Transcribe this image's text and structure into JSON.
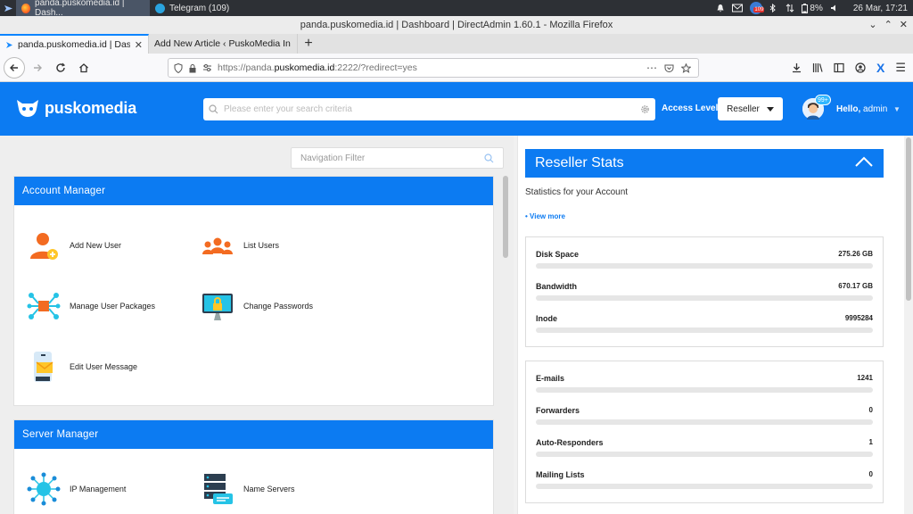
{
  "taskbar": {
    "tasks": [
      {
        "label": "panda.puskomedia.id | Dash...",
        "icon": "firefox-icon"
      },
      {
        "label": "Telegram (109)",
        "icon": "telegram-icon"
      }
    ],
    "notification_count": "109",
    "battery": "8%",
    "clock": "26 Mar, 17:21"
  },
  "window": {
    "title": "panda.puskomedia.id | Dashboard | DirectAdmin 1.60.1 - Mozilla Firefox"
  },
  "browser": {
    "tabs": [
      {
        "label": "panda.puskomedia.id | Dash",
        "active": true
      },
      {
        "label": "Add New Article ‹ PuskoMedia In",
        "active": false
      }
    ],
    "url_prefix": "https://panda.",
    "url_domain": "puskomedia.id",
    "url_suffix": ":2222/?redirect=yes"
  },
  "header": {
    "brand": "puskomedia",
    "search_placeholder": "Please enter your search criteria",
    "access_label": "Access Level",
    "level_value": "Reseller",
    "badge": "99+",
    "hello_prefix": "Hello,",
    "hello_user": "admin"
  },
  "nav_filter": {
    "placeholder": "Navigation Filter"
  },
  "account_manager": {
    "title": "Account Manager",
    "items": [
      {
        "label": "Add New User",
        "icon": "add-user-icon"
      },
      {
        "label": "List Users",
        "icon": "users-group-icon"
      },
      {
        "label": "Manage User Packages",
        "icon": "packages-icon"
      },
      {
        "label": "Change Passwords",
        "icon": "lock-monitor-icon"
      },
      {
        "label": "Edit User Message",
        "icon": "message-icon"
      }
    ]
  },
  "server_manager": {
    "title": "Server Manager",
    "items": [
      {
        "label": "IP Management",
        "icon": "network-icon"
      },
      {
        "label": "Name Servers",
        "icon": "server-icon"
      }
    ]
  },
  "reseller_stats": {
    "title": "Reseller Stats",
    "subtitle": "Statistics for your Account",
    "view_more": "• View more",
    "group1": [
      {
        "label": "Disk Space",
        "value": "275.26 GB",
        "fill": 0
      },
      {
        "label": "Bandwidth",
        "value": "670.17 GB",
        "fill": 0
      },
      {
        "label": "Inode",
        "value": "9995284",
        "fill": 0
      }
    ],
    "group2": [
      {
        "label": "E-mails",
        "value": "1241",
        "fill": 0
      },
      {
        "label": "Forwarders",
        "value": "0",
        "fill": 0
      },
      {
        "label": "Auto-Responders",
        "value": "1",
        "fill": 0
      },
      {
        "label": "Mailing Lists",
        "value": "0",
        "fill": 0
      }
    ]
  },
  "colors": {
    "brand_blue": "#0c7bf2",
    "icon_orange": "#f36b21",
    "icon_teal": "#25c3e6"
  }
}
